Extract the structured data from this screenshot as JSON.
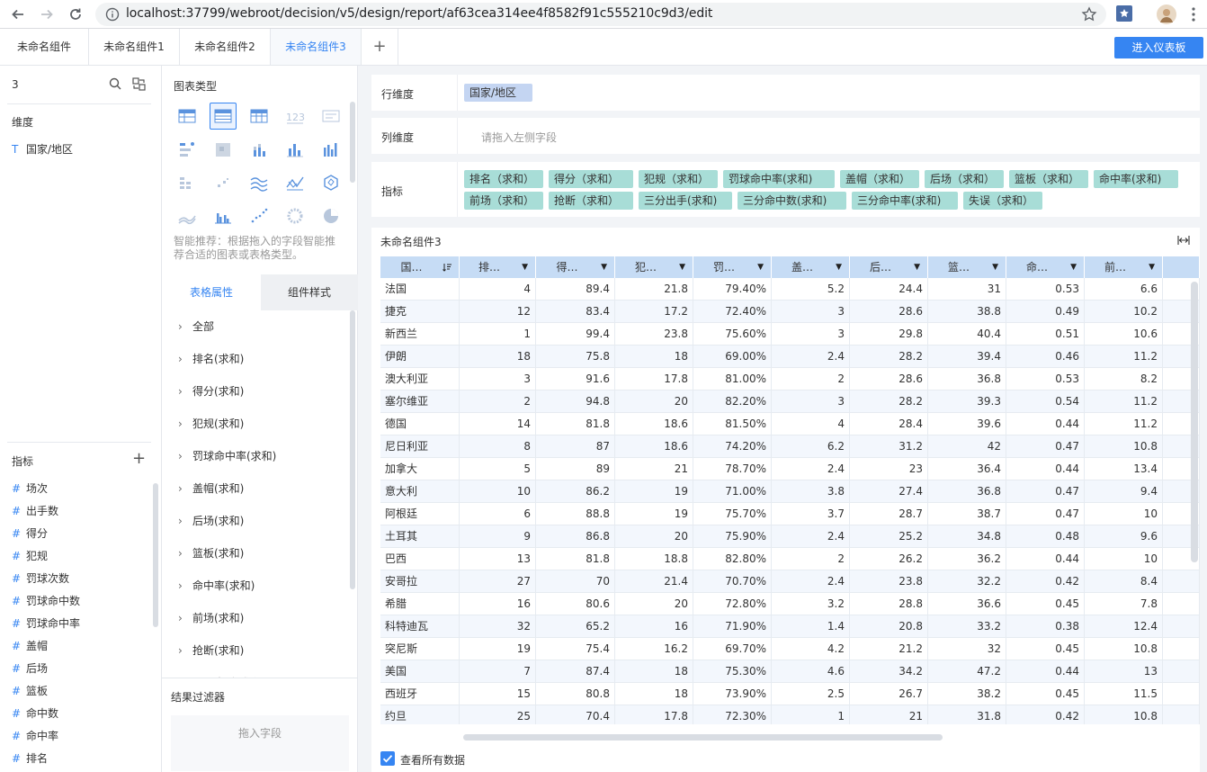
{
  "browser": {
    "url": "localhost:37799/webroot/decision/v5/design/report/af63cea314ee4f8582f91c555210c9d3/edit"
  },
  "component_tabs": [
    {
      "label": "未命名组件"
    },
    {
      "label": "未命名组件1"
    },
    {
      "label": "未命名组件2"
    },
    {
      "label": "未命名组件3"
    }
  ],
  "enter_dashboard_label": "进入仪表板",
  "left_panel": {
    "search_value": "3",
    "dimension_title": "维度",
    "dimensions": [
      {
        "icon": "T",
        "label": "国家/地区"
      }
    ],
    "measure_title": "指标",
    "measures": [
      {
        "icon": "#",
        "label": "场次"
      },
      {
        "icon": "#",
        "label": "出手数"
      },
      {
        "icon": "#",
        "label": "得分"
      },
      {
        "icon": "#",
        "label": "犯规"
      },
      {
        "icon": "#",
        "label": "罚球次数"
      },
      {
        "icon": "#",
        "label": "罚球命中数"
      },
      {
        "icon": "#",
        "label": "罚球命中率"
      },
      {
        "icon": "#",
        "label": "盖帽"
      },
      {
        "icon": "#",
        "label": "后场"
      },
      {
        "icon": "#",
        "label": "篮板"
      },
      {
        "icon": "#",
        "label": "命中数"
      },
      {
        "icon": "#",
        "label": "命中率"
      },
      {
        "icon": "#",
        "label": "排名"
      }
    ]
  },
  "mid_panel": {
    "chart_type_title": "图表类型",
    "smart_hint": "智能推荐：根据拖入的字段智能推荐合适的图表或表格类型。",
    "tab_table_attr": "表格属性",
    "tab_component_style": "组件样式",
    "props": [
      "全部",
      "排名(求和)",
      "得分(求和)",
      "犯规(求和)",
      "罚球命中率(求和)",
      "盖帽(求和)",
      "后场(求和)",
      "篮板(求和)",
      "命中率(求和)",
      "前场(求和)",
      "抢断(求和)",
      "三分出手(求和)"
    ],
    "filter_title": "结果过滤器",
    "filter_drop": "拖入字段"
  },
  "row_dim": {
    "label": "行维度",
    "fields": [
      "国家/地区"
    ]
  },
  "col_dim": {
    "label": "列维度",
    "placeholder": "请拖入左侧字段"
  },
  "measures_box": {
    "label": "指标",
    "fields": [
      "排名（求和）",
      "得分（求和）",
      "犯规（求和）",
      "罚球命中率(求和)",
      "盖帽（求和）",
      "后场（求和）",
      "篮板（求和）",
      "命中率(求和)",
      "前场（求和）",
      "抢断（求和）",
      "三分出手(求和)",
      "三分命中数(求和)",
      "三分命中率(求和)",
      "失误（求和）"
    ]
  },
  "table_card": {
    "title": "未命名组件3",
    "view_all_label": "查看所有数据",
    "view_all_checked": true,
    "headers": [
      "国…",
      "排…",
      "得…",
      "犯…",
      "罚…",
      "盖…",
      "后…",
      "篮…",
      "命…",
      "前…"
    ],
    "rows": [
      [
        "法国",
        "4",
        "89.4",
        "21.8",
        "79.40%",
        "5.2",
        "24.4",
        "31",
        "0.53",
        "6.6"
      ],
      [
        "捷克",
        "12",
        "83.4",
        "17.2",
        "72.40%",
        "3",
        "28.6",
        "38.8",
        "0.49",
        "10.2"
      ],
      [
        "新西兰",
        "1",
        "99.4",
        "23.8",
        "75.60%",
        "3",
        "29.8",
        "40.4",
        "0.51",
        "10.6"
      ],
      [
        "伊朗",
        "18",
        "75.8",
        "18",
        "69.00%",
        "2.4",
        "28.2",
        "39.4",
        "0.46",
        "11.2"
      ],
      [
        "澳大利亚",
        "3",
        "91.6",
        "17.8",
        "81.00%",
        "2",
        "28.6",
        "36.8",
        "0.53",
        "8.2"
      ],
      [
        "塞尔维亚",
        "2",
        "94.8",
        "20",
        "82.20%",
        "3",
        "28.2",
        "39.3",
        "0.54",
        "11.2"
      ],
      [
        "德国",
        "14",
        "81.8",
        "18.6",
        "81.50%",
        "4",
        "28.4",
        "39.6",
        "0.44",
        "11.2"
      ],
      [
        "尼日利亚",
        "8",
        "87",
        "18.6",
        "74.20%",
        "6.2",
        "31.2",
        "42",
        "0.47",
        "10.8"
      ],
      [
        "加拿大",
        "5",
        "89",
        "21",
        "78.70%",
        "2.4",
        "23",
        "36.4",
        "0.44",
        "13.4"
      ],
      [
        "意大利",
        "10",
        "86.2",
        "19",
        "71.00%",
        "3.8",
        "27.4",
        "36.8",
        "0.47",
        "9.4"
      ],
      [
        "阿根廷",
        "6",
        "88.8",
        "19",
        "75.70%",
        "3.7",
        "28.7",
        "38.7",
        "0.47",
        "10"
      ],
      [
        "土耳其",
        "9",
        "86.8",
        "20",
        "75.90%",
        "2.4",
        "25.2",
        "34.8",
        "0.48",
        "9.6"
      ],
      [
        "巴西",
        "13",
        "81.8",
        "18.8",
        "82.80%",
        "2",
        "26.2",
        "36.2",
        "0.44",
        "10"
      ],
      [
        "安哥拉",
        "27",
        "70",
        "21.4",
        "70.70%",
        "2.4",
        "23.8",
        "32.2",
        "0.42",
        "8.4"
      ],
      [
        "希腊",
        "16",
        "80.6",
        "20",
        "72.80%",
        "3.2",
        "28.8",
        "36.6",
        "0.45",
        "7.8"
      ],
      [
        "科特迪瓦",
        "32",
        "65.2",
        "16",
        "71.90%",
        "1.4",
        "20.8",
        "33.2",
        "0.38",
        "12.4"
      ],
      [
        "突尼斯",
        "19",
        "75.4",
        "16.2",
        "69.70%",
        "4.2",
        "21.2",
        "32",
        "0.45",
        "10.8"
      ],
      [
        "美国",
        "7",
        "87.4",
        "18",
        "75.30%",
        "4.6",
        "34.2",
        "47.2",
        "0.44",
        "13"
      ],
      [
        "西班牙",
        "15",
        "80.8",
        "18",
        "73.90%",
        "2.5",
        "26.7",
        "38.2",
        "0.45",
        "11.5"
      ],
      [
        "约旦",
        "25",
        "70.4",
        "17.8",
        "72.30%",
        "1",
        "21",
        "31.8",
        "0.42",
        "10.8"
      ]
    ]
  }
}
